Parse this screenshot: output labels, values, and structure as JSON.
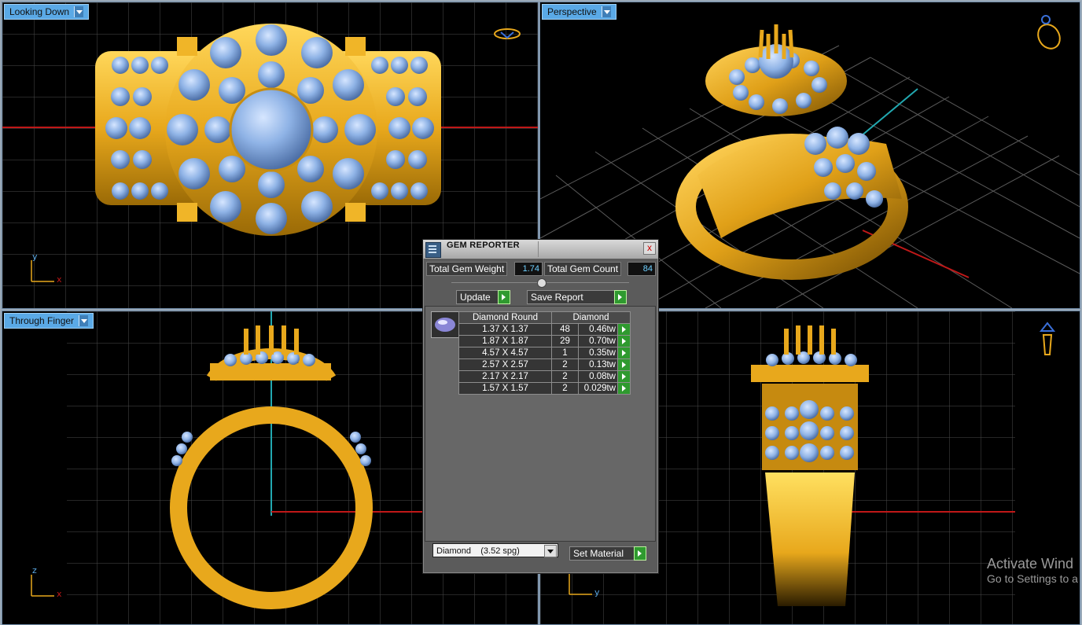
{
  "viewports": {
    "top": {
      "label": "Looking Down"
    },
    "perspective": {
      "label": "Perspective"
    },
    "front": {
      "label": "Through Finger"
    }
  },
  "axes": {
    "top": {
      "v": "y",
      "h": "x"
    },
    "front": {
      "v": "z",
      "h": "x"
    },
    "side": {
      "v": "z",
      "h": "y"
    }
  },
  "gem_reporter": {
    "title": "GEM REPORTER",
    "close": "x",
    "total_weight_label": "Total Gem Weight",
    "total_weight": "1.74",
    "total_count_label": "Total Gem Count",
    "total_count": "84",
    "update_label": "Update",
    "save_label": "Save Report",
    "col_shape": "Diamond Round",
    "col_material": "Diamond",
    "rows": [
      {
        "size": "1.37 X 1.37",
        "count": "48",
        "weight": "0.46tw"
      },
      {
        "size": "1.87 X 1.87",
        "count": "29",
        "weight": "0.70tw"
      },
      {
        "size": "4.57 X 4.57",
        "count": "1",
        "weight": "0.35tw"
      },
      {
        "size": "2.57 X 2.57",
        "count": "2",
        "weight": "0.13tw"
      },
      {
        "size": "2.17 X 2.17",
        "count": "2",
        "weight": "0.08tw"
      },
      {
        "size": "1.57 X 1.57",
        "count": "2",
        "weight": "0.029tw"
      }
    ],
    "material_select": "Diamond    (3.52 spg)",
    "set_material_label": "Set Material"
  },
  "watermark": {
    "line1": "Activate Wind",
    "line2": "Go to Settings to a"
  },
  "colors": {
    "gold": "#e8a81c",
    "stone": "#8fb3e6",
    "grid": "#5a5a5a",
    "tab": "#5aa9e6"
  }
}
